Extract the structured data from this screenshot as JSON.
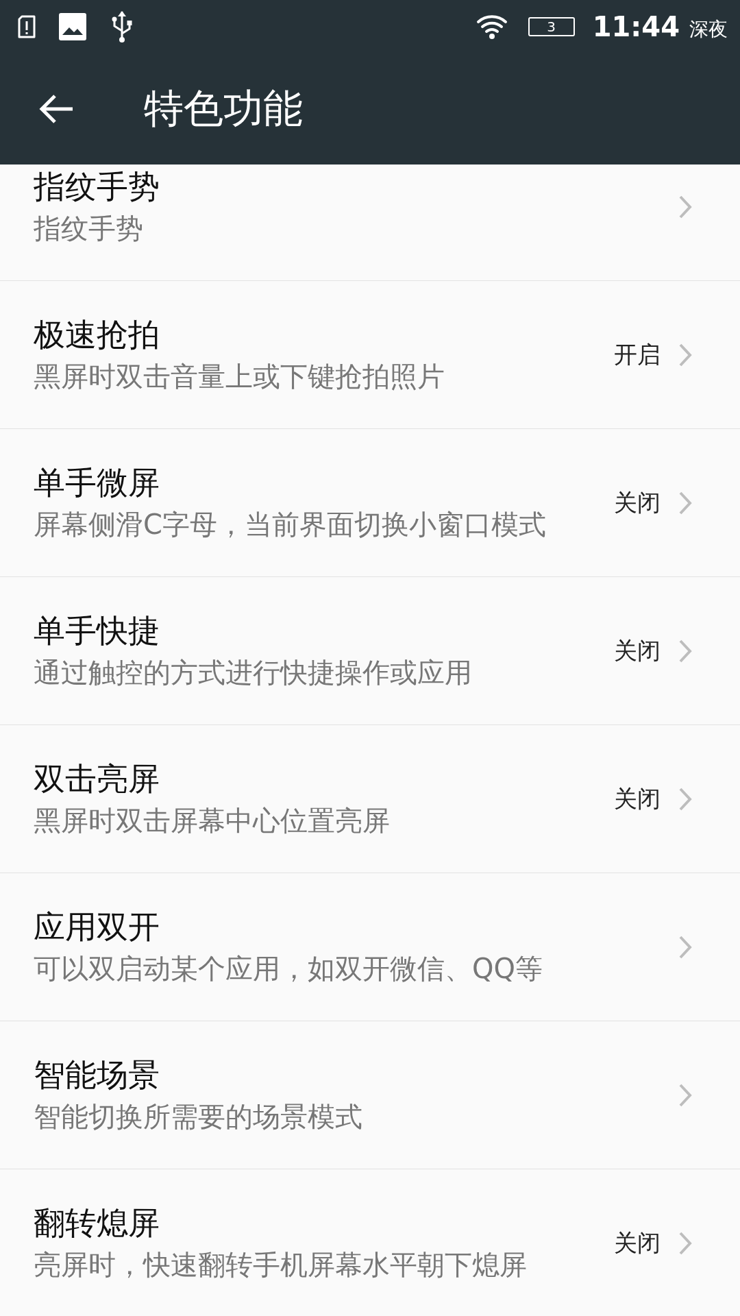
{
  "status_bar": {
    "battery": "3",
    "time": "11:44",
    "period": "深夜"
  },
  "toolbar": {
    "title": "特色功能"
  },
  "items": [
    {
      "title": "指纹手势",
      "subtitle": "指纹手势"
    },
    {
      "title": "极速抢拍",
      "subtitle": "黑屏时双击音量上或下键抢拍照片",
      "value": "开启"
    },
    {
      "title": "单手微屏",
      "subtitle": "屏幕侧滑C字母，当前界面切换小窗口模式",
      "value": "关闭"
    },
    {
      "title": "单手快捷",
      "subtitle": "通过触控的方式进行快捷操作或应用",
      "value": "关闭"
    },
    {
      "title": "双击亮屏",
      "subtitle": "黑屏时双击屏幕中心位置亮屏",
      "value": "关闭"
    },
    {
      "title": "应用双开",
      "subtitle": "可以双启动某个应用，如双开微信、QQ等"
    },
    {
      "title": "智能场景",
      "subtitle": "智能切换所需要的场景模式"
    },
    {
      "title": "翻转熄屏",
      "subtitle": "亮屏时，快速翻转手机屏幕水平朝下熄屏",
      "value": "关闭"
    }
  ]
}
